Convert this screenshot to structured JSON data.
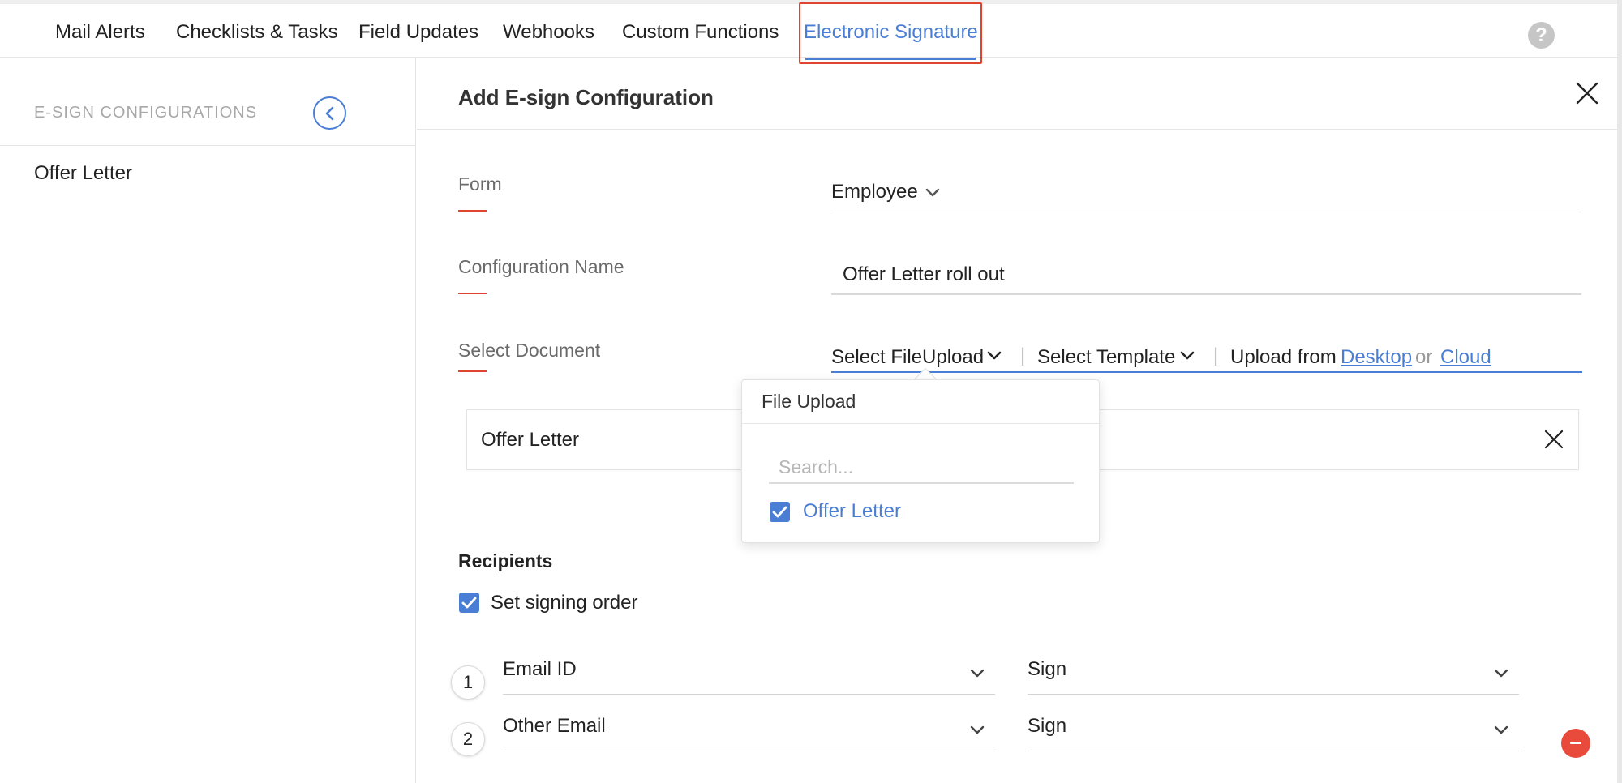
{
  "nav": {
    "tabs": [
      {
        "label": "Mail Alerts"
      },
      {
        "label": "Checklists & Tasks"
      },
      {
        "label": "Field Updates"
      },
      {
        "label": "Webhooks"
      },
      {
        "label": "Custom Functions"
      },
      {
        "label": "Electronic Signature",
        "active": true
      }
    ],
    "help_label": "?"
  },
  "sidebar": {
    "title": "E-SIGN CONFIGURATIONS",
    "items": [
      {
        "label": "Offer Letter"
      }
    ]
  },
  "panel": {
    "title": "Add E-sign Configuration",
    "form": {
      "label": "Form",
      "value": "Employee"
    },
    "config_name": {
      "label": "Configuration Name",
      "value": "Offer Letter roll out"
    },
    "select_document": {
      "label": "Select Document",
      "file_upload_label": "Select FileUpload",
      "template_label": "Select Template",
      "upload_from_label": "Upload from",
      "desktop_link": "Desktop",
      "or_text": "or",
      "cloud_link": "Cloud"
    },
    "selected_doc": "Offer Letter",
    "dropdown": {
      "header": "File Upload",
      "search_placeholder": "Search...",
      "options": [
        {
          "label": "Offer Letter",
          "checked": true
        }
      ]
    },
    "recipients": {
      "title": "Recipients",
      "signing_order_label": "Set signing order",
      "signing_order_checked": true,
      "rows": [
        {
          "step": "1",
          "recipient": "Email ID",
          "action": "Sign"
        },
        {
          "step": "2",
          "recipient": "Other Email",
          "action": "Sign"
        }
      ]
    }
  },
  "colors": {
    "accent": "#4a7ed4",
    "highlight": "#e0442f",
    "remove": "#e84a3b"
  }
}
